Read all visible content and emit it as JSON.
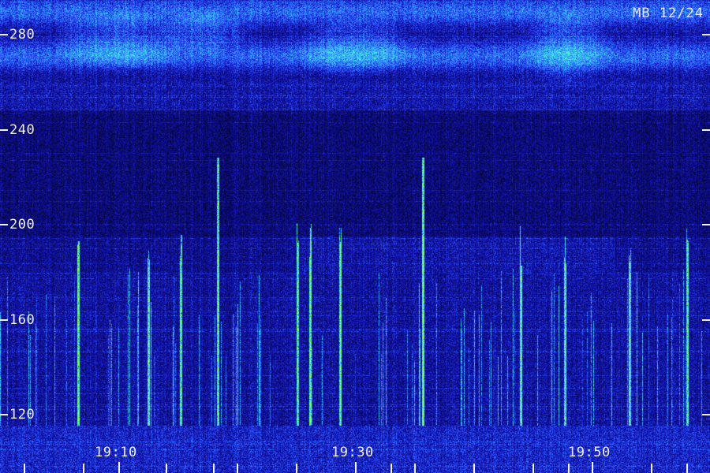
{
  "chart_data": {
    "type": "heatmap",
    "stamp": "MB 12/24",
    "y_axis": {
      "ticks": [
        120,
        160,
        200,
        240,
        280
      ],
      "tick_labels": [
        "120",
        "160",
        "200",
        "240",
        "280"
      ],
      "range": [
        110,
        290
      ]
    },
    "x_axis": {
      "tick_labels": [
        "19:10",
        "19:30",
        "19:50"
      ],
      "labeled_ticks": [
        5,
        15,
        25
      ],
      "range": [
        0,
        30
      ],
      "minor_ticks": [
        1,
        3.5,
        5,
        7,
        9,
        10,
        12.5,
        15,
        16.5,
        17.5,
        20,
        22.5,
        24,
        25,
        27.5,
        29
      ]
    },
    "colormap": [
      "#05052e",
      "#0a0a6e",
      "#1515b8",
      "#2a55ff",
      "#3ab8ff",
      "#48ffd0",
      "#8cff40"
    ]
  }
}
